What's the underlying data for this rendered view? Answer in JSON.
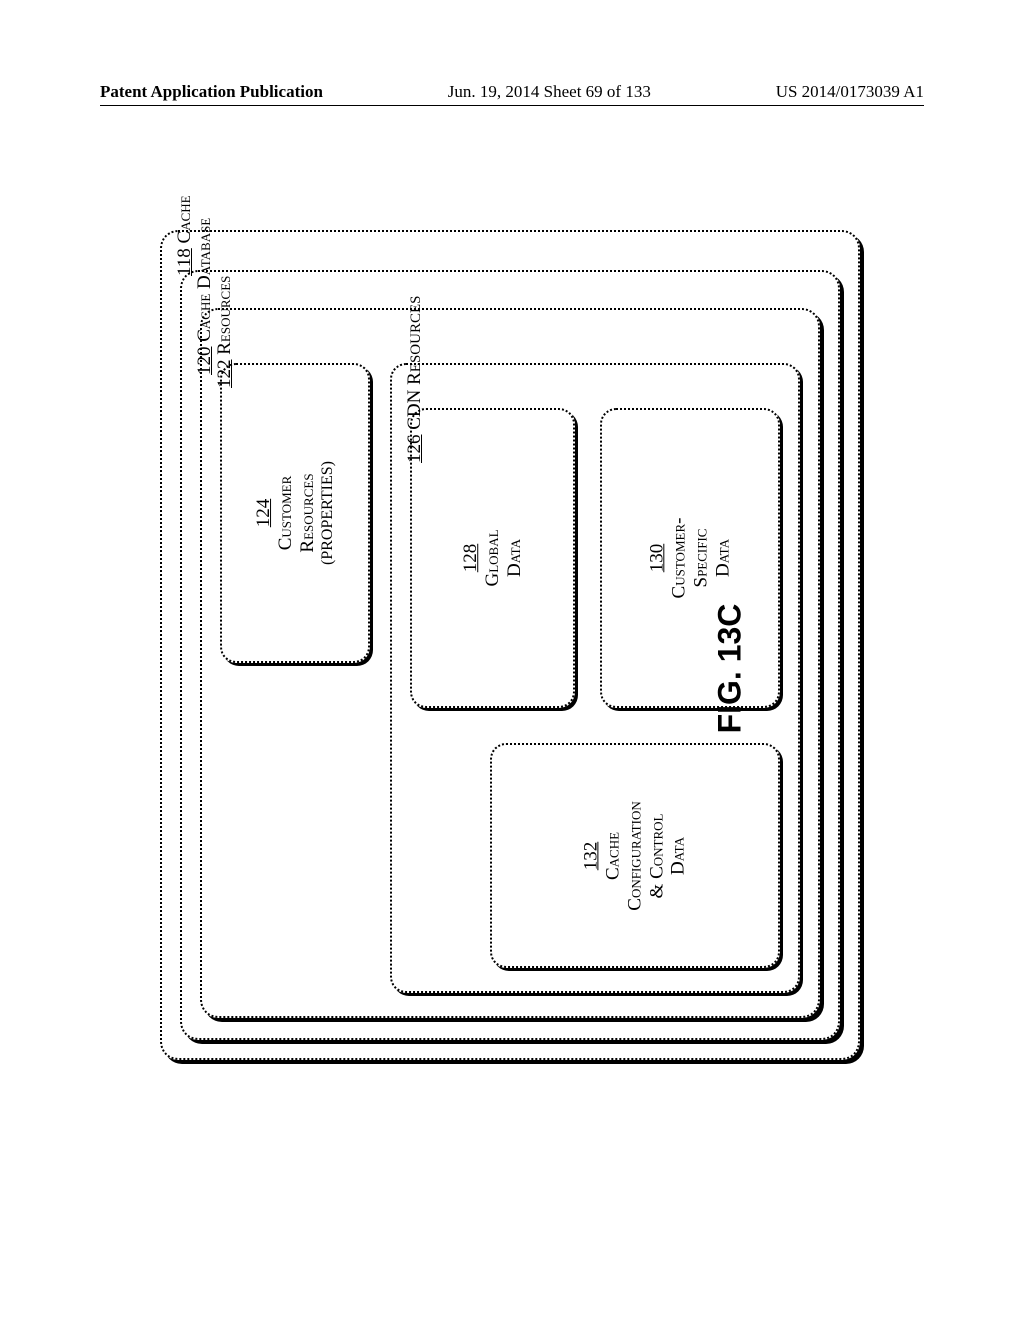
{
  "header": {
    "left": "Patent Application Publication",
    "center": "Jun. 19, 2014  Sheet 69 of 133",
    "right": "US 2014/0173039 A1"
  },
  "figure_label": "FIG. 13C",
  "diagram": {
    "b118": {
      "num": "118",
      "name": "Cache"
    },
    "b120": {
      "num": "120",
      "name": "Cache Database"
    },
    "b122": {
      "num": "122",
      "name": "Resources"
    },
    "b124": {
      "num": "124",
      "l1": "Customer",
      "l2": "Resources",
      "l3": "(properties)"
    },
    "b126": {
      "num": "126",
      "name": "CDN Resources"
    },
    "b128": {
      "num": "128",
      "l1": "Global",
      "l2": "Data"
    },
    "b130": {
      "num": "130",
      "l1": "Customer-",
      "l2": "Specific",
      "l3": "Data"
    },
    "b132": {
      "num": "132",
      "l1": "Cache",
      "l2": "Configuration",
      "l3": "& Control",
      "l4": "Data"
    }
  }
}
